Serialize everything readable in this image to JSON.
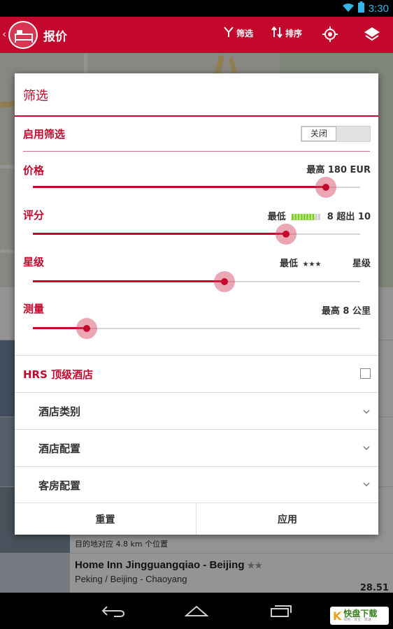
{
  "status_bar": {
    "time": "3:30",
    "wifi_icon": "wifi-icon",
    "battery_icon": "battery-icon"
  },
  "app_bar": {
    "title": "报价",
    "back_icon": "chevron-left-icon",
    "logo_icon": "bed-icon",
    "actions": [
      {
        "label": "筛选",
        "icon": "filter-icon"
      },
      {
        "label": "排序",
        "icon": "sort-icon"
      },
      {
        "label": "",
        "icon": "locate-icon"
      },
      {
        "label": "",
        "icon": "layers-icon"
      }
    ],
    "color": "#c4072d"
  },
  "background": {
    "rows": [
      {
        "title": "Home Inn Jingguangqiao - Beijing",
        "stars": "★★",
        "subtitle": "Peking / Beijing - Chaoyang"
      }
    ],
    "distance_text": "目的地对应 4.8 km 个位置",
    "price_fragment": "28.51"
  },
  "dialog": {
    "title": "筛选",
    "enable_filter": {
      "label": "启用筛选",
      "toggle_state": "关闭"
    },
    "sliders": [
      {
        "label": "价格",
        "value_text": "最高 180 EUR",
        "fraction": 0.896
      },
      {
        "label": "评分",
        "value_prefix": "最低",
        "rating_level": 8,
        "rating_max": 10,
        "value_suffix": "8 超出 10",
        "fraction": 0.774
      },
      {
        "label": "星级",
        "value_prefix": "最低",
        "stars": "★★★",
        "value_suffix": "星级",
        "fraction": 0.585
      },
      {
        "label": "测量",
        "value_text": "最高 8 公里",
        "fraction": 0.165
      }
    ],
    "top_hotel": {
      "label": "HRS 顶级酒店",
      "checked": false
    },
    "expanders": [
      {
        "label": "酒店类别",
        "icon": "chevron-down-icon"
      },
      {
        "label": "酒店配置",
        "icon": "chevron-down-icon"
      },
      {
        "label": "客房配置",
        "icon": "chevron-down-icon"
      }
    ],
    "buttons": {
      "reset": "重置",
      "apply": "应用"
    },
    "accent": "#c4072d"
  },
  "nav_bar": {
    "back": "back-nav-icon",
    "home": "home-nav-icon",
    "recents": "recents-nav-icon"
  },
  "watermark": {
    "logo": "K",
    "text": "快盘下载",
    "sub": "绿色 · 安全 · 高速"
  }
}
